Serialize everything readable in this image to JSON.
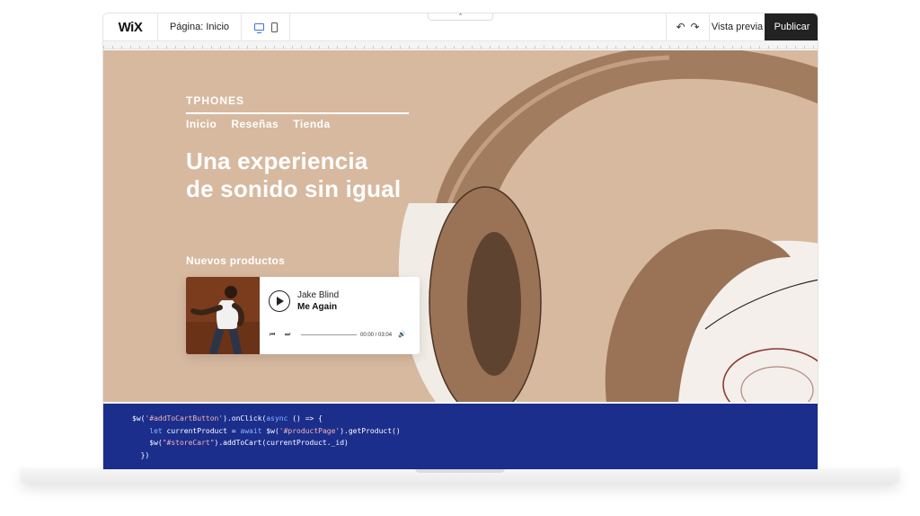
{
  "toolbar": {
    "logo": "WiX",
    "page_label": "Página: Inicio",
    "collapse_glyph": "⌃",
    "preview_label": "Vista previa",
    "publish_label": "Publicar",
    "icons": [
      "desktop-icon",
      "mobile-icon",
      "undo-icon",
      "redo-icon"
    ],
    "undo_glyph": "↶",
    "redo_glyph": "↷"
  },
  "site": {
    "brand": "TPHONES",
    "nav": [
      "Inicio",
      "Reseñas",
      "Tienda"
    ],
    "headline_1": "Una experiencia",
    "headline_2": "de sonido sin igual",
    "section_label": "Nuevos productos",
    "background_color": "#d7b9a0"
  },
  "player": {
    "artist": "Jake Blind",
    "track": "Me Again",
    "time": "00:00 / 03:04",
    "prev_glyph": "⏮",
    "next_glyph": "⏭",
    "volume_glyph": "🔊",
    "progress": 0
  },
  "code": {
    "line1_a": "$w(",
    "line1_b": "'#addToCartButton'",
    "line1_c": ").onClick(",
    "line1_d": "async",
    "line1_e": " () => {",
    "line2_a": "    ",
    "line2_b": "let",
    "line2_c": " currentProduct = ",
    "line2_d": "await",
    "line2_e": " $w(",
    "line2_f": "'#productPage'",
    "line2_g": ").getProduct()",
    "line3_a": "    $w(",
    "line3_b": "\"#storeCart\"",
    "line3_c": ").addToCart(currentProduct._id)",
    "line4": "  })"
  }
}
